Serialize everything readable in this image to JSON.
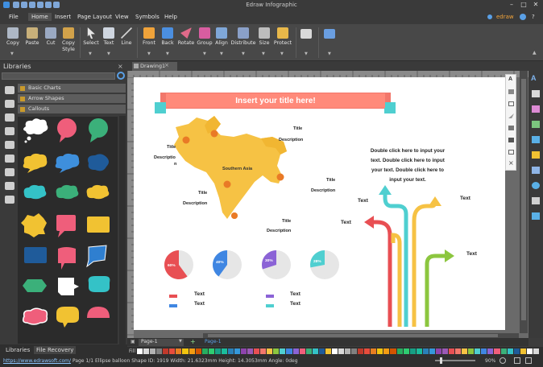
{
  "app": {
    "title": "Edraw Infographic",
    "user": "edraw"
  },
  "menu": [
    "File",
    "Home",
    "Insert",
    "Page Layout",
    "View",
    "Symbols",
    "Help"
  ],
  "ribbon": {
    "buttons": [
      {
        "label": "Copy",
        "icon": "copy-icon"
      },
      {
        "label": "Paste",
        "icon": "paste-icon"
      },
      {
        "label": "Cut",
        "icon": "cut-icon"
      },
      {
        "label": "Copy",
        "label2": "Style",
        "icon": "format-painter-icon"
      },
      {
        "label": "Select",
        "icon": "select-arrow-icon"
      },
      {
        "label": "Text",
        "icon": "text-icon"
      },
      {
        "label": "Line",
        "icon": "line-icon"
      },
      {
        "label": "Front",
        "icon": "bring-front-icon"
      },
      {
        "label": "Back",
        "icon": "send-back-icon"
      },
      {
        "label": "Rotate",
        "icon": "rotate-icon"
      },
      {
        "label": "Group",
        "icon": "group-icon"
      },
      {
        "label": "Align",
        "icon": "align-icon"
      },
      {
        "label": "Distribute",
        "icon": "distribute-icon"
      },
      {
        "label": "Size",
        "icon": "size-icon"
      },
      {
        "label": "Protect",
        "icon": "lock-icon"
      }
    ]
  },
  "libraries": {
    "header": "Libraries",
    "categories": [
      "Basic Charts",
      "Arrow Shapes",
      "Callouts"
    ],
    "tabs": [
      "Libraries",
      "File Recovery"
    ]
  },
  "document": {
    "tab": "Drawing1"
  },
  "infographic": {
    "title": "Insert your title here!",
    "map_label": "Southern Asia",
    "callouts": [
      {
        "title": "Title",
        "desc": "Description"
      },
      {
        "title": "Title",
        "desc": "Descriptio",
        "desc2": "n"
      },
      {
        "title": "Title",
        "desc": "Description"
      },
      {
        "title": "Title",
        "desc": "Description"
      },
      {
        "title": "Title",
        "desc": "Description"
      }
    ],
    "paragraph": [
      "Double click here to input your",
      "text. Double click here to input",
      "your text. Double click here to",
      "input your text."
    ],
    "arrow_texts": [
      "Text",
      "Text",
      "Text",
      "Text"
    ],
    "pies": [
      {
        "label": "60%",
        "value": 60,
        "color": "#e84f53"
      },
      {
        "label": "40%",
        "value": 40,
        "color": "#3f86e2"
      },
      {
        "label": "30%",
        "value": 30,
        "color": "#8b63d6"
      },
      {
        "label": "28%",
        "value": 28,
        "color": "#4fcfd0"
      }
    ],
    "legend": [
      {
        "text": "Text",
        "color": "#e84f53"
      },
      {
        "text": "Text",
        "color": "#3f86e2"
      },
      {
        "text": "Text",
        "color": "#8b63d6"
      },
      {
        "text": "Text",
        "color": "#4fcfd0"
      }
    ]
  },
  "pages": {
    "tab": "Page-1",
    "active": "Page-1"
  },
  "fill_label": "Fill",
  "status": {
    "url": "https://www.edrawsoft.com/",
    "page": "Page 1/1",
    "shape": "Ellipse balloon",
    "shape_id": "Shape ID: 1919",
    "width": "Width: 21.6323mm",
    "height": "Height: 14.3053mm",
    "angle": "Angle: 0deg",
    "zoom": "90%"
  }
}
